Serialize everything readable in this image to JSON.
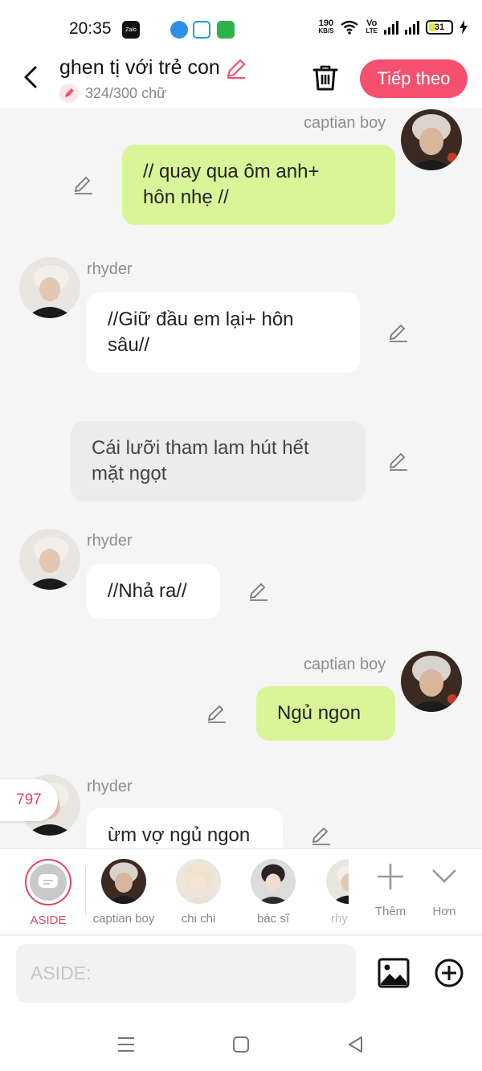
{
  "status_bar": {
    "time": "20:35",
    "speed": "190",
    "speed_unit": "KB/S",
    "volte_top": "Vo",
    "volte_bottom": "LTE",
    "battery": "31",
    "zalo_label": "Zalo"
  },
  "header": {
    "title": "ghen tị với trẻ con",
    "word_count": "324/300 chữ",
    "next_label": "Tiếp theo"
  },
  "messages": [
    {
      "sender": "captian boy",
      "text": "// quay qua ôm anh+\nhôn nhẹ //",
      "side": "right"
    },
    {
      "sender": "rhyder",
      "text": "//Giữ đầu em lại+ hôn\nsâu//",
      "side": "left"
    },
    {
      "sender": "",
      "text": "Cái lưỡi tham lam hút hết\nmặt ngọt",
      "side": "aside"
    },
    {
      "sender": "rhyder",
      "text": "//Nhả ra//",
      "side": "left"
    },
    {
      "sender": "captian boy",
      "text": "Ngủ ngon",
      "side": "right"
    },
    {
      "sender": "rhyder",
      "text": "ừm vợ ngủ ngon",
      "side": "left"
    }
  ],
  "counter_badge": "797",
  "characters": [
    {
      "label": "ASIDE"
    },
    {
      "label": "captian boy"
    },
    {
      "label": "chi chi"
    },
    {
      "label": "bác sĩ"
    },
    {
      "label": "rhy"
    },
    {
      "label": "Thêm"
    },
    {
      "label": "Hơn"
    }
  ],
  "input": {
    "placeholder": "ASIDE:"
  },
  "colors": {
    "accent": "#f5506e",
    "bubble_green": "#d8f598",
    "bubble_white": "#ffffff",
    "bubble_gray": "#ececec"
  }
}
